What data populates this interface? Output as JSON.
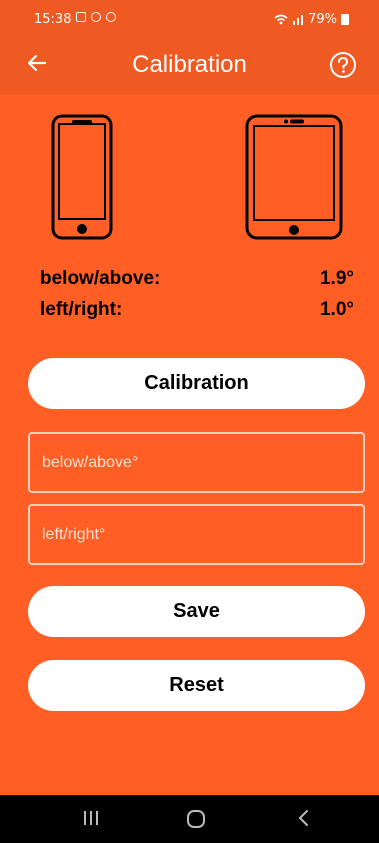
{
  "status": {
    "time": "15:38",
    "battery": "79%"
  },
  "appbar": {
    "title": "Calibration"
  },
  "readings": {
    "vertical_label": "below/above:",
    "vertical_value": "1.9°",
    "horizontal_label": "left/right:",
    "horizontal_value": "1.0°"
  },
  "buttons": {
    "calibration": "Calibration",
    "save": "Save",
    "reset": "Reset"
  },
  "inputs": {
    "vertical_placeholder": "below/above°",
    "horizontal_placeholder": "left/right°"
  },
  "colors": {
    "background": "#ff5e25",
    "bar": "#ef5a22",
    "button": "#ffffff"
  },
  "icons": {
    "back": "arrow-left-icon",
    "help": "help-icon",
    "phone": "phone-icon",
    "tablet": "tablet-icon"
  }
}
